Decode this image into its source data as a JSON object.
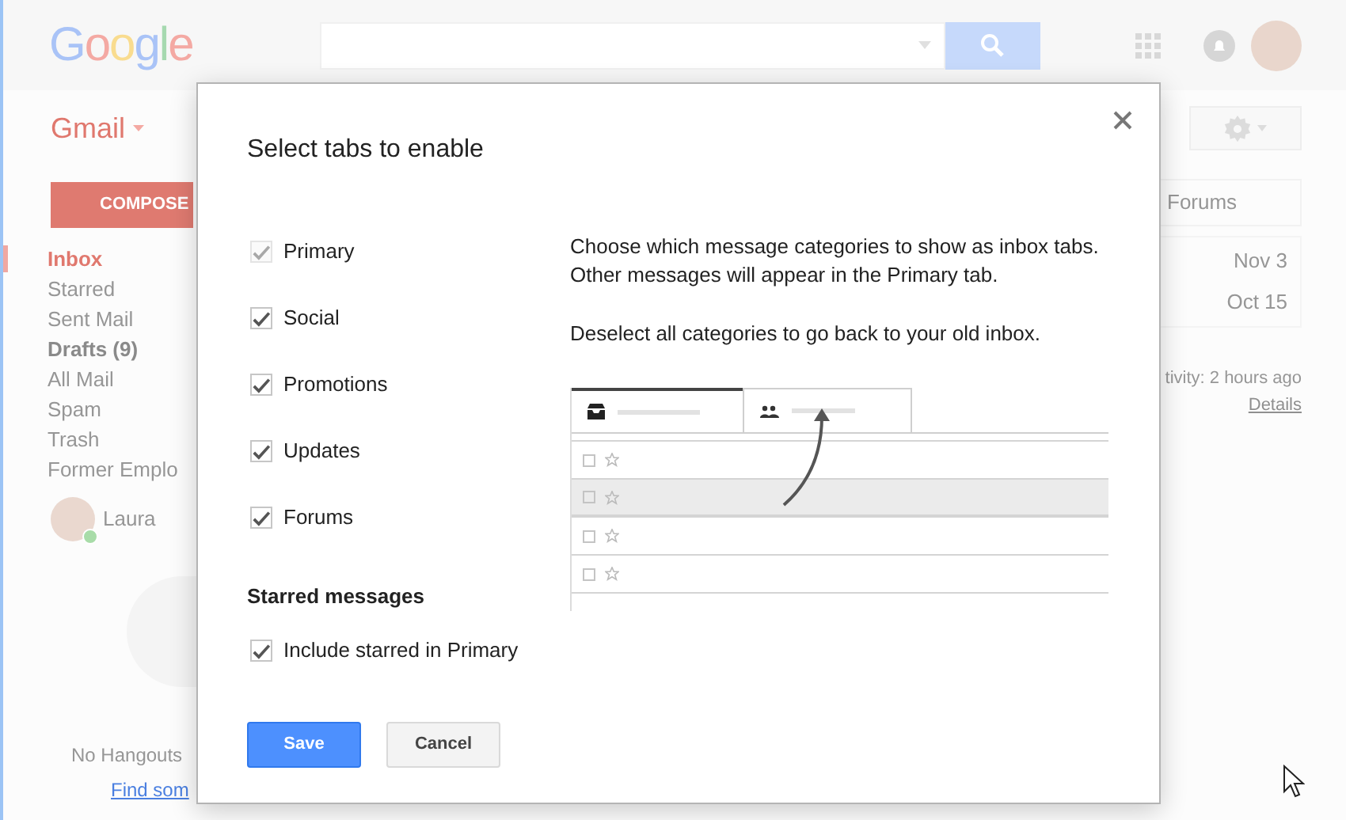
{
  "header": {
    "logo": "Google"
  },
  "app_bar": {
    "app_name": "Gmail"
  },
  "compose_button": "COMPOSE",
  "sidebar": {
    "items": [
      {
        "label": "Inbox",
        "selected": true,
        "unread": true
      },
      {
        "label": "Starred",
        "selected": false,
        "unread": false
      },
      {
        "label": "Sent Mail",
        "selected": false,
        "unread": false
      },
      {
        "label": "Drafts (9)",
        "selected": false,
        "unread": true
      },
      {
        "label": "All Mail",
        "selected": false,
        "unread": false
      },
      {
        "label": "Spam",
        "selected": false,
        "unread": false
      },
      {
        "label": "Trash",
        "selected": false,
        "unread": false
      },
      {
        "label": "Former Emplo",
        "selected": false,
        "unread": false
      }
    ]
  },
  "contact": {
    "name": "Laura",
    "online": true
  },
  "hangouts": {
    "empty_text": "No Hangouts",
    "link": "Find som"
  },
  "inbox_tab": "Forums",
  "message_dates": [
    "Nov 3",
    "Oct 15"
  ],
  "activity": {
    "text": "tivity: 2 hours ago",
    "link": "Details"
  },
  "dialog": {
    "title": "Select tabs to enable",
    "categories": [
      {
        "label": "Primary",
        "checked": true,
        "disabled": true
      },
      {
        "label": "Social",
        "checked": true,
        "disabled": false
      },
      {
        "label": "Promotions",
        "checked": true,
        "disabled": false
      },
      {
        "label": "Updates",
        "checked": true,
        "disabled": false
      },
      {
        "label": "Forums",
        "checked": true,
        "disabled": false
      }
    ],
    "paragraphs": [
      "Choose which message categories to show as inbox tabs. Other messages will appear in the Primary tab.",
      "Deselect all categories to go back to your old inbox."
    ],
    "starred": {
      "heading": "Starred messages",
      "option": {
        "label": "Include starred in Primary",
        "checked": true,
        "disabled": false
      }
    },
    "buttons": [
      {
        "label": "Save",
        "kind": "primary"
      },
      {
        "label": "Cancel",
        "kind": "secondary"
      }
    ]
  }
}
